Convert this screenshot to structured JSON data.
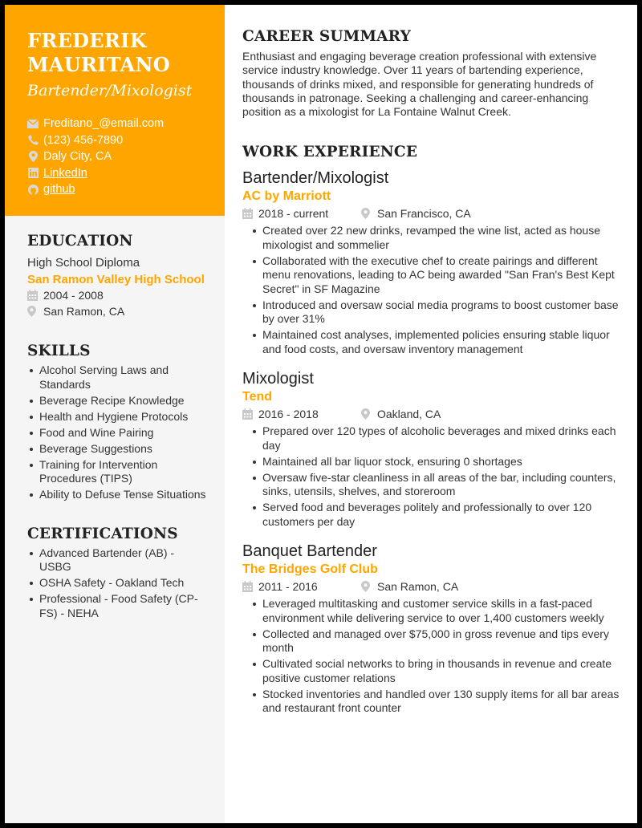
{
  "header": {
    "name_line1": "FREDERIK",
    "name_line2": "MAURITANO",
    "title": "Bartender/Mixologist",
    "contacts": [
      {
        "icon": "envelope-icon",
        "text": "Freditano_@email.com",
        "link": false
      },
      {
        "icon": "phone-icon",
        "text": "(123) 456-7890",
        "link": false
      },
      {
        "icon": "location-pin-icon",
        "text": "Daly City, CA",
        "link": false
      },
      {
        "icon": "linkedin-icon",
        "text": "LinkedIn",
        "link": true
      },
      {
        "icon": "github-icon",
        "text": "github",
        "link": true
      }
    ]
  },
  "colors": {
    "accent": "#ffa500",
    "sidebar_bg": "#f5f5f5",
    "text": "#333333",
    "icon_gray": "#c8c8c8"
  },
  "education": {
    "heading": "EDUCATION",
    "degree": "High School Diploma",
    "school": "San Ramon Valley High School",
    "dates": "2004 - 2008",
    "location": "San Ramon, CA"
  },
  "skills": {
    "heading": "SKILLS",
    "items": [
      "Alcohol Serving Laws and Standards",
      "Beverage Recipe Knowledge",
      "Health and Hygiene Protocols",
      "Food and Wine Pairing",
      "Beverage Suggestions",
      "Training for Intervention Procedures (TIPS)",
      "Ability to Defuse Tense Situations"
    ]
  },
  "certifications": {
    "heading": "CERTIFICATIONS",
    "items": [
      "Advanced Bartender (AB) - USBG",
      "OSHA Safety - Oakland Tech",
      "Professional - Food Safety (CP-FS) - NEHA"
    ]
  },
  "summary": {
    "heading": "CAREER SUMMARY",
    "text": "Enthusiast and engaging beverage creation professional with extensive service industry knowledge. Over 11 years of bartending experience, thousands of drinks mixed, and responsible for generating hundreds of thousands in patronage. Seeking a challenging and career-enhancing position as a mixologist for La Fontaine Walnut Creek."
  },
  "experience": {
    "heading": "WORK EXPERIENCE",
    "jobs": [
      {
        "title": "Bartender/Mixologist",
        "company": "AC by Marriott",
        "dates": "2018 - current",
        "location": "San Francisco, CA",
        "bullets": [
          "Created over 22 new drinks, revamped the wine list, acted as house mixologist and sommelier",
          "Collaborated with the executive chef to create pairings and different menu renovations, leading to AC being awarded \"San Fran's Best Kept Secret\" in SF Magazine",
          "Introduced and oversaw social media programs to boost customer base by over 31%",
          "Maintained cost analyses, implemented policies ensuring stable liquor and food costs, and oversaw inventory management"
        ]
      },
      {
        "title": "Mixologist",
        "company": "Tend",
        "dates": "2016 - 2018",
        "location": "Oakland, CA",
        "bullets": [
          "Prepared over 120 types of alcoholic beverages and mixed drinks each day",
          "Maintained all bar liquor stock, ensuring 0 shortages",
          "Oversaw five-star cleanliness in all areas of the bar, including counters, sinks, utensils, shelves, and storeroom",
          "Served food and beverages politely and professionally to over 120 customers per day"
        ]
      },
      {
        "title": "Banquet Bartender",
        "company": "The Bridges Golf Club",
        "dates": "2011 - 2016",
        "location": "San Ramon, CA",
        "bullets": [
          "Leveraged multitasking and customer service skills in a fast-paced environment while delivering service to over 1,400 customers weekly",
          "Collected and managed over $75,000 in gross revenue and tips every month",
          "Cultivated social networks to bring in thousands in revenue and create positive customer relations",
          "Stocked inventories and handled over 130 supply items for all bar areas and restaurant front counter"
        ]
      }
    ]
  }
}
